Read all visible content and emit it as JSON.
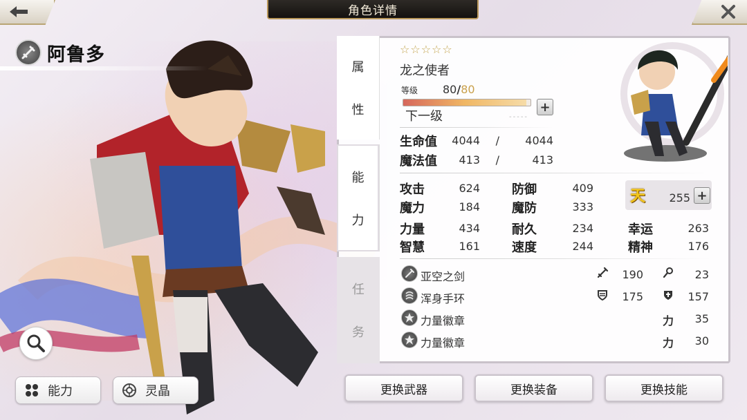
{
  "header": {
    "title": "角色详情"
  },
  "character": {
    "name": "阿鲁多",
    "title": "龙之使者",
    "rarity_stars": "☆☆☆☆☆",
    "level_label": "等级",
    "level": "80",
    "level_max": "80",
    "next_level_label": "下一级",
    "exp_progress": 0.97
  },
  "tabs": {
    "attributes": [
      "属",
      "性"
    ],
    "ability": [
      "能",
      "力"
    ],
    "mission": [
      "任",
      "务"
    ]
  },
  "vitals": [
    {
      "label": "生命值",
      "current": "4044",
      "sep": "/",
      "max": "4044"
    },
    {
      "label": "魔法值",
      "current": "413",
      "sep": "/",
      "max": "413"
    }
  ],
  "stats": [
    {
      "label": "攻击",
      "value": "624"
    },
    {
      "label": "防御",
      "value": "409"
    },
    {
      "label": "魔力",
      "value": "184"
    },
    {
      "label": "魔防",
      "value": "333"
    },
    {
      "label": "力量",
      "value": "434"
    },
    {
      "label": "耐久",
      "value": "234"
    },
    {
      "label": "幸运",
      "value": "263"
    },
    {
      "label": "智慧",
      "value": "161"
    },
    {
      "label": "速度",
      "value": "244"
    },
    {
      "label": "精神",
      "value": "176"
    }
  ],
  "sky": {
    "icon": "天",
    "value": "255"
  },
  "equipment": [
    {
      "name": "亚空之剑",
      "icon": "sword-icon",
      "stat1_icon": "attack-icon",
      "stat1": "190",
      "stat2_icon": "magic-wand-icon",
      "stat2": "23"
    },
    {
      "name": "浑身手环",
      "icon": "bracelet-icon",
      "stat1_icon": "defense-shield-icon",
      "stat1": "175",
      "stat2_icon": "magic-shield-icon",
      "stat2": "157"
    },
    {
      "name": "力量徽章",
      "icon": "emblem-icon",
      "stat_label": "力",
      "stat": "35"
    },
    {
      "name": "力量徽章",
      "icon": "emblem-icon",
      "stat_label": "力",
      "stat": "30"
    }
  ],
  "left_buttons": {
    "ability": "能力",
    "crystal": "灵晶"
  },
  "bottom_buttons": {
    "change_weapon": "更换武器",
    "change_gear": "更换装备",
    "change_skill": "更换技能"
  }
}
